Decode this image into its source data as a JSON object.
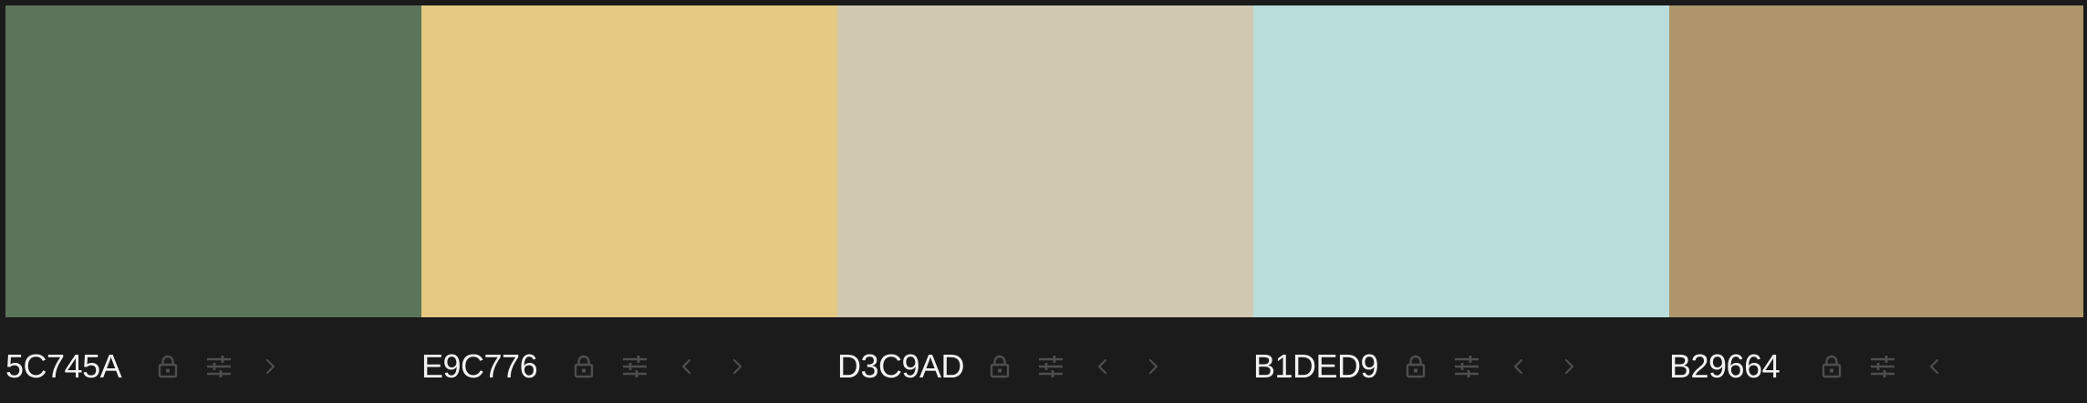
{
  "colors": [
    {
      "hex": "5C745A",
      "color": "#5C745A",
      "has_prev": false,
      "has_next": true
    },
    {
      "hex": "E9C776",
      "color": "#E4C983",
      "has_prev": true,
      "has_next": true
    },
    {
      "hex": "D3C9AD",
      "color": "#D1C8B1",
      "has_prev": true,
      "has_next": true
    },
    {
      "hex": "B1DED9",
      "color": "#B9DDDB",
      "has_prev": true,
      "has_next": true
    },
    {
      "hex": "B29664",
      "color": "#AE966A",
      "has_prev": true,
      "has_next": false
    }
  ],
  "icons": {
    "lock": "lock-icon",
    "adjust": "sliders-icon",
    "prev": "chevron-left-icon",
    "next": "chevron-right-icon"
  },
  "theme": {
    "background": "#1b1b1b",
    "text": "#f2f2f2",
    "icon": "#4e4e4e"
  }
}
